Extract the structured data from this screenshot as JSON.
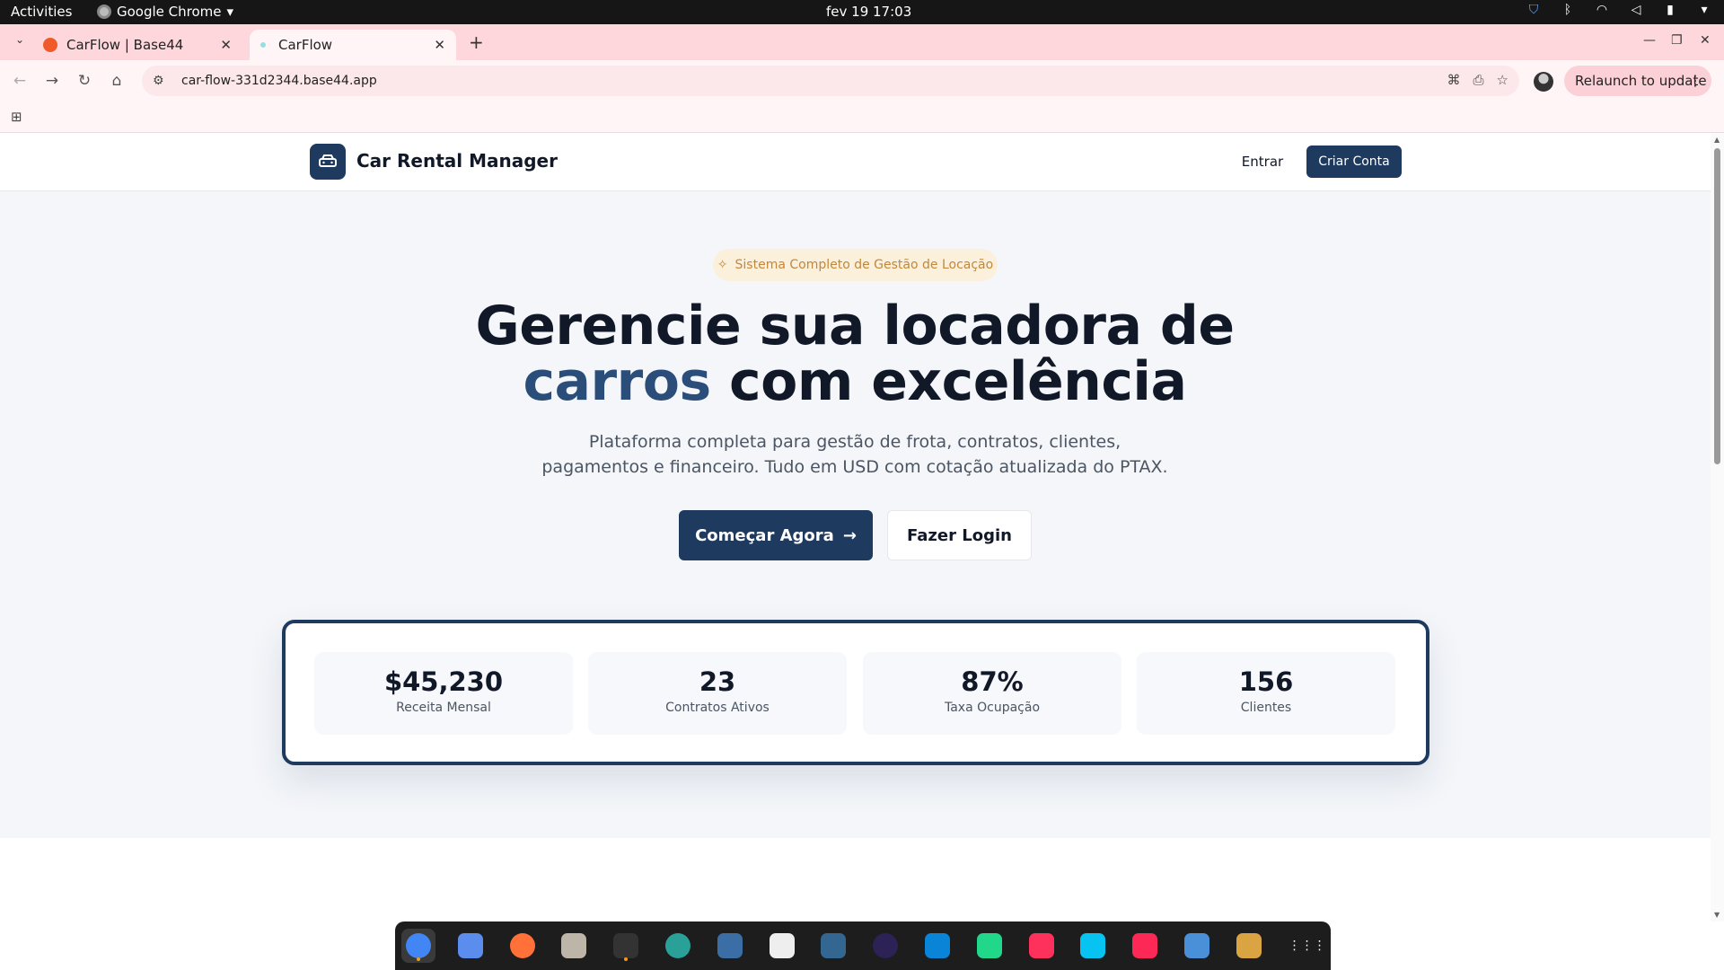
{
  "system_bar": {
    "activities": "Activities",
    "app_name": "Google Chrome",
    "clock": "fev 19  17:03"
  },
  "browser": {
    "tabs": [
      {
        "title": "CarFlow | Base44",
        "active": false
      },
      {
        "title": "CarFlow",
        "active": true
      }
    ],
    "url": "car-flow-331d2344.base44.app",
    "relaunch_label": "Relaunch to update"
  },
  "site": {
    "brand": "Car Rental Manager",
    "nav": {
      "login": "Entrar",
      "signup": "Criar Conta"
    },
    "hero": {
      "badge": "Sistema Completo de Gestão de Locação",
      "title_line1": "Gerencie sua locadora de",
      "title_accent": "carros",
      "title_line2_rest": " com excelência",
      "subtitle_line1": "Plataforma completa para gestão de frota, contratos, clientes,",
      "subtitle_line2": "pagamentos e financeiro. Tudo em USD com cotação atualizada do PTAX.",
      "cta_primary": "Começar Agora",
      "cta_secondary": "Fazer Login"
    },
    "stats": [
      {
        "value": "$45,230",
        "label": "Receita Mensal"
      },
      {
        "value": "23",
        "label": "Contratos Ativos"
      },
      {
        "value": "87%",
        "label": "Taxa Ocupação"
      },
      {
        "value": "156",
        "label": "Clientes"
      }
    ]
  },
  "colors": {
    "primary": "#1e3a5f",
    "accent_text": "#2b4d7a",
    "badge_bg": "#fbf0dc",
    "badge_text": "#c2873a",
    "tabstrip_bg": "#fdd7dc"
  },
  "dock": {
    "apps": [
      {
        "icon": "chrome-icon",
        "color": "#4285f4"
      },
      {
        "icon": "text-editor-icon",
        "color": "#5b8def"
      },
      {
        "icon": "firefox-icon",
        "color": "#ff7139"
      },
      {
        "icon": "files-icon",
        "color": "#bdb6a8"
      },
      {
        "icon": "terminal-icon",
        "color": "#333333"
      },
      {
        "icon": "crossover-icon",
        "color": "#2aa198"
      },
      {
        "icon": "mysql-workbench-icon",
        "color": "#3b6ea5"
      },
      {
        "icon": "inkscape-icon",
        "color": "#eeeeee"
      },
      {
        "icon": "pgadmin-icon",
        "color": "#336791"
      },
      {
        "icon": "eclipse-icon",
        "color": "#2c2255"
      },
      {
        "icon": "vscode-icon",
        "color": "#0a84d6"
      },
      {
        "icon": "pycharm-icon",
        "color": "#21d789"
      },
      {
        "icon": "intellij-icon",
        "color": "#fe315d"
      },
      {
        "icon": "webstorm-icon",
        "color": "#07c3f2"
      },
      {
        "icon": "rubymine-icon",
        "color": "#fe2857"
      },
      {
        "icon": "system-monitor-icon",
        "color": "#4a90d9"
      },
      {
        "icon": "brush-icon",
        "color": "#d9a441"
      },
      {
        "icon": "app-grid-icon",
        "color": "#1d1d1d"
      }
    ]
  }
}
